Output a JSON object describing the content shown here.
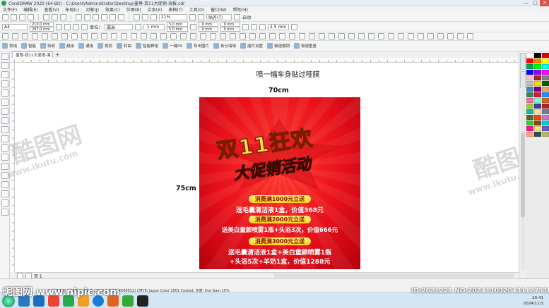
{
  "window": {
    "title": "CorelDRAW 2020 (64-Bit) - C:\\Users\\Administrator\\Desktop\\墨尊-双11大促销-海报.cdr",
    "buttons": [
      "—",
      "□",
      "✕"
    ]
  },
  "menu": [
    "文件(F)",
    "编辑(E)",
    "查看(V)",
    "布局(L)",
    "对象(J)",
    "效果(C)",
    "位图(B)",
    "文本(X)",
    "表格(T)",
    "工具(O)",
    "窗口(W)",
    "帮助(H)"
  ],
  "toolbar_standard": {
    "zoom": "21%",
    "snap": "贴齐(T)",
    "launch": "启动"
  },
  "property_bar": {
    "paper": "A4",
    "width": "210.0 mm",
    "height": "297.0 mm",
    "units_label": "单位：",
    "units": "毫米",
    "nudge": ".1 mm",
    "dup_x": "5.0 mm",
    "dup_y": "5.0 mm",
    "outline": "2.5 mm",
    "pos_x1": ".0 mm",
    "pos_y1": ".0 mm",
    "pos_x2": ".0 mm",
    "pos_y2": ".0 mm"
  },
  "plugin_toolbar": [
    "常用",
    "智能",
    "特效",
    "超级",
    "通用",
    "裁剪",
    "转曲",
    "智能群组",
    "一键PS",
    "导出图片",
    "拆分海域",
    "插件设置",
    "极速撤销",
    "极速重复"
  ],
  "document_tab": "墨尊-双11大促销-海...",
  "status": {
    "page_label": "页 1",
    "status_text": "C:0 M:100 Y:96 K:0 (G8 R:230 G:0 B:18 #E60012)  CMYK: Japan Color 2001 Coated; 灰度: Dot Gain 15%"
  },
  "clock": {
    "time": "20:41",
    "date": "2024/11/3"
  },
  "artwork": {
    "heading": "喷一幅车身贴过哑膜",
    "width_label": "70cm",
    "height_label": "75cm",
    "poster": {
      "headline": "双11狂欢",
      "subheadline": "大促销活动",
      "tiers": [
        {
          "badge": "消费满1000元立送",
          "gift": "送毛囊清洁液1盒，价值368元"
        },
        {
          "badge": "消费满2000元立送",
          "gift": "送美白童颜喷雾1瓶+头浴3次，价值666元"
        },
        {
          "badge": "消费满3000元立送",
          "gift_line1": "送毛囊清洁液1盒+美白童颜喷雾1瓶",
          "gift_line2": "+头浴5次+羊奶1盒，价值1288元"
        }
      ]
    }
  },
  "watermarks": {
    "brand": "酷图网",
    "url": "www.ikutu.com",
    "bottom_left": "昵图网 www.nipic.com",
    "bottom_right": "ID:2621221 NO:20241103204311275108"
  },
  "colors": {
    "poster_red": "#e8101a",
    "badge_yellow": "#ffd21c",
    "headline_yellow": "#ffe14a"
  },
  "palette": [
    "#ffffff",
    "#000000",
    "#e60012",
    "#ff0000",
    "#ff7f00",
    "#ffff00",
    "#00a650",
    "#00ff00",
    "#00ffff",
    "#0000ff",
    "#8b00ff",
    "#ff00ff",
    "#ffc0cb",
    "#a52a2a",
    "#808080",
    "#c0c0c0",
    "#ffd700",
    "#006400",
    "#4682b4",
    "#800080",
    "#f4a460",
    "#2e8b57",
    "#dc143c",
    "#1e90ff",
    "#ff69b4",
    "#7fffd4",
    "#d2691e",
    "#9acd32",
    "#483d8b",
    "#b22222",
    "#20b2aa",
    "#ffdead",
    "#708090",
    "#556b2f",
    "#ff4500",
    "#da70d6",
    "#32cd32",
    "#8b4513",
    "#00ced1",
    "#ff1493",
    "#f0e68c",
    "#6a5acd",
    "#ffa07a",
    "#2f4f4f",
    "#bdb76b"
  ]
}
